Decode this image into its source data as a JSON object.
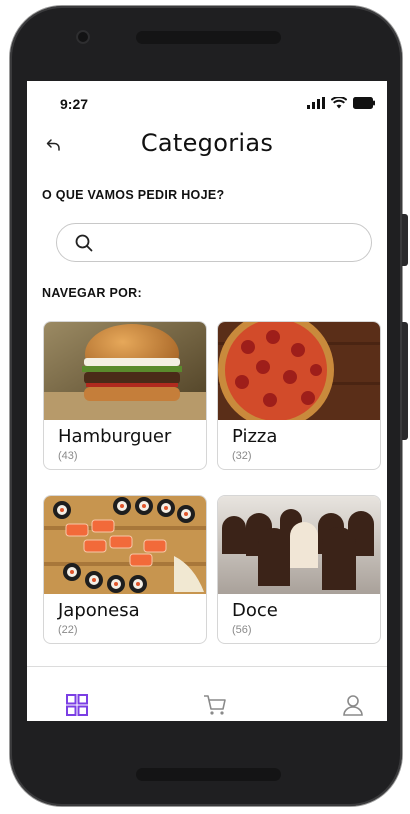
{
  "status": {
    "time": "9:27"
  },
  "header": {
    "title": "Categorias"
  },
  "question": "O QUE VAMOS PEDIR HOJE?",
  "search": {
    "placeholder": "",
    "value": ""
  },
  "browse_label": "NAVEGAR POR:",
  "categories": [
    {
      "name": "Hamburguer",
      "count": "(43)"
    },
    {
      "name": "Pizza",
      "count": "(32)"
    },
    {
      "name": "Japonesa",
      "count": "(22)"
    },
    {
      "name": "Doce",
      "count": "(56)"
    }
  ],
  "colors": {
    "accent": "#7b3fe4",
    "text": "#111111",
    "muted": "#8a8a8a",
    "nav_inactive": "#8a8a8a"
  },
  "icons": {
    "back": "back-arrow-icon",
    "search": "search-icon",
    "home": "grid-icon",
    "cart": "cart-icon",
    "profile": "user-icon"
  }
}
